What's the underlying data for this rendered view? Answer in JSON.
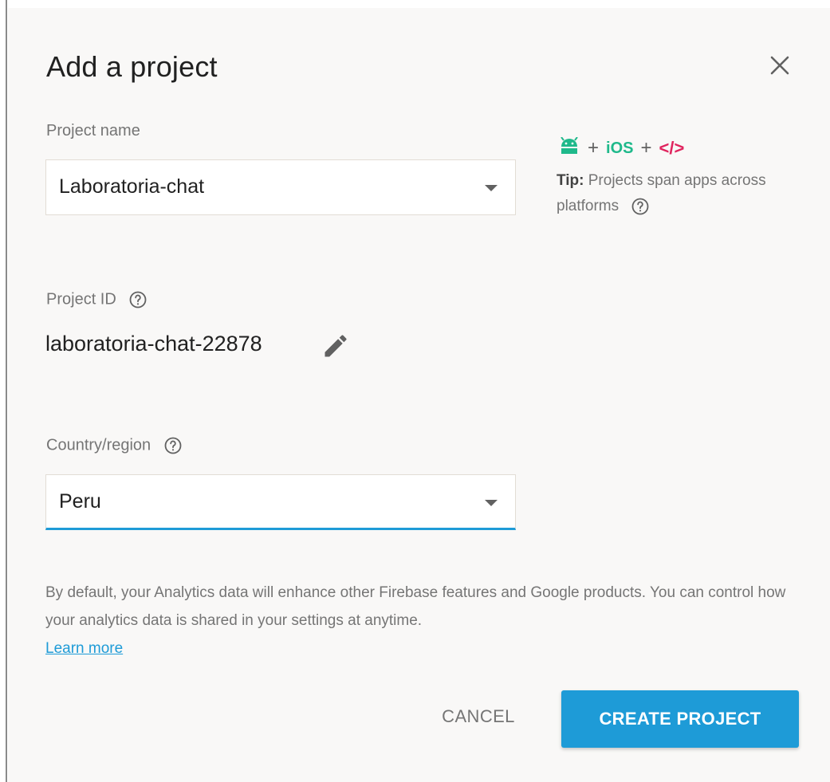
{
  "dialog": {
    "title": "Add a project",
    "close_icon": "close-icon"
  },
  "project_name": {
    "label": "Project name",
    "value": "Laboratoria-chat"
  },
  "tip": {
    "icons": [
      "android-icon",
      "ios-icon",
      "web-code-icon"
    ],
    "plus": "+",
    "ios_label": "iOS",
    "code_label": "</>",
    "bold": "Tip:",
    "text": " Projects span apps across platforms",
    "help_icon": "help-icon"
  },
  "project_id": {
    "label": "Project ID",
    "value": "laboratoria-chat-22878",
    "edit_icon": "edit-pencil-icon"
  },
  "country": {
    "label": "Country/region",
    "value": "Peru"
  },
  "analytics": {
    "text": "By default, your Analytics data will enhance other Firebase features and Google products. You can control how your analytics data is shared in your settings at anytime.",
    "link": "Learn more"
  },
  "actions": {
    "cancel": "CANCEL",
    "create": "CREATE PROJECT"
  },
  "colors": {
    "accent": "#1e9bd7",
    "android": "#1fb98b",
    "code": "#e0245e",
    "dialog_bg": "#f9f8f7"
  }
}
